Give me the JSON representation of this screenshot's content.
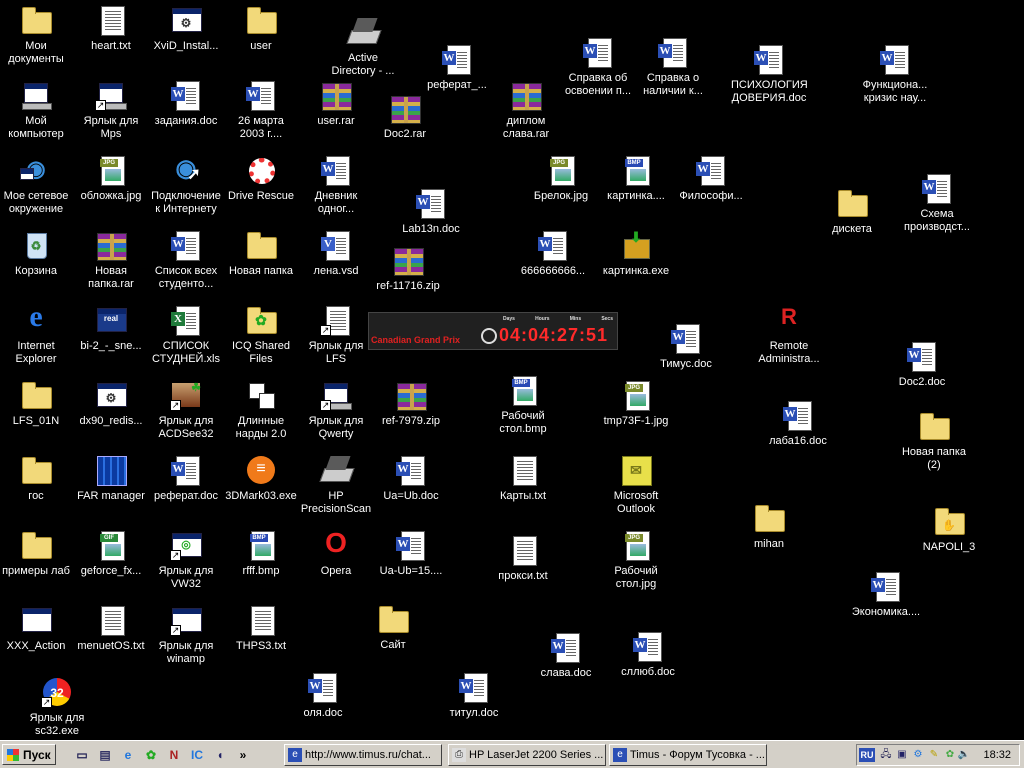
{
  "colors": {
    "desktop": "#000000",
    "taskbar": "#d4d0c8",
    "label": "#ffffff",
    "word_blue": "#2b4fb5",
    "timer_red": "#ff2a2a"
  },
  "icons": [
    {
      "label": "Мои\nдокументы",
      "kind": "folder"
    },
    {
      "label": "heart.txt",
      "kind": "txt"
    },
    {
      "label": "XviD_Instal...",
      "kind": "setup"
    },
    {
      "label": "user",
      "kind": "folder"
    },
    {
      "label": "Active\nDirectory - ...",
      "kind": "scanner"
    },
    {
      "label": "реферат_...",
      "kind": "doc"
    },
    {
      "label": "Справка об\nосвоении п...",
      "kind": "doc"
    },
    {
      "label": "Справка о\nналичии к...",
      "kind": "doc"
    },
    {
      "label": "ПСИХОЛОГИЯ\nДОВЕРИЯ.doc",
      "kind": "doc"
    },
    {
      "label": "Функциона...\nкризис нау...",
      "kind": "doc"
    },
    {
      "label": "Мой\nкомпьютер",
      "kind": "computer"
    },
    {
      "label": "Ярлык для\nMps",
      "kind": "computer",
      "shortcut": true
    },
    {
      "label": "задания.doc",
      "kind": "doc"
    },
    {
      "label": "26 марта\n2003 г....",
      "kind": "doc"
    },
    {
      "label": "user.rar",
      "kind": "rar"
    },
    {
      "label": "Doc2.rar",
      "kind": "rar"
    },
    {
      "label": "диплом\nслава.rar",
      "kind": "rar"
    },
    {
      "label": "Мое сетевое\nокружение",
      "kind": "network"
    },
    {
      "label": "обложка.jpg",
      "kind": "jpg"
    },
    {
      "label": "Подключение\nк Интернету",
      "kind": "globe"
    },
    {
      "label": "Drive Rescue",
      "kind": "lifebuoy"
    },
    {
      "label": "Дневник\nодног...",
      "kind": "doc"
    },
    {
      "label": "Lab13n.doc",
      "kind": "doc"
    },
    {
      "label": "Брелок.jpg",
      "kind": "jpg"
    },
    {
      "label": "картинка....",
      "kind": "bmp"
    },
    {
      "label": "Философи...",
      "kind": "doc"
    },
    {
      "label": "дискета",
      "kind": "folder"
    },
    {
      "label": "Схема\nпроизводст...",
      "kind": "doc"
    },
    {
      "label": "Корзина",
      "kind": "bin"
    },
    {
      "label": "Новая\nпапка.rar",
      "kind": "rar"
    },
    {
      "label": "Список всех\nстуденто...",
      "kind": "doc"
    },
    {
      "label": "Новая папка",
      "kind": "folder"
    },
    {
      "label": "лена.vsd",
      "kind": "vsd"
    },
    {
      "label": "ref-11716.zip",
      "kind": "rar"
    },
    {
      "label": "666666666...",
      "kind": "doc"
    },
    {
      "label": "картинка.exe",
      "kind": "exe"
    },
    {
      "label": "Internet\nExplorer",
      "kind": "ie"
    },
    {
      "label": "bi-2_-_sne...",
      "kind": "real"
    },
    {
      "label": "СПИСОК\nСТУДНЕЙ.xls",
      "kind": "xls"
    },
    {
      "label": "ICQ Shared\nFiles",
      "kind": "icqfolder"
    },
    {
      "label": "Ярлык для\nLFS",
      "kind": "txt",
      "shortcut": true
    },
    {
      "label": "Тимус.doc",
      "kind": "doc"
    },
    {
      "label": "Remote\nAdministra...",
      "kind": "radmin"
    },
    {
      "label": "Doc2.doc",
      "kind": "doc"
    },
    {
      "label": "LFS_01N",
      "kind": "folder"
    },
    {
      "label": "dx90_redis...",
      "kind": "setup"
    },
    {
      "label": "Ярлык для\nACDSee32",
      "kind": "acdsee",
      "shortcut": true
    },
    {
      "label": "Длинные\nнарды 2.0",
      "kind": "dice"
    },
    {
      "label": "Ярлык для\nQwerty",
      "kind": "computer",
      "shortcut": true
    },
    {
      "label": "ref-7979.zip",
      "kind": "rar"
    },
    {
      "label": "Рабочий\nстол.bmp",
      "kind": "bmp"
    },
    {
      "label": "tmp73F-1.jpg",
      "kind": "jpg"
    },
    {
      "label": "лаба16.doc",
      "kind": "doc"
    },
    {
      "label": "Новая папка\n(2)",
      "kind": "folder"
    },
    {
      "label": "гос",
      "kind": "folder"
    },
    {
      "label": "FAR manager",
      "kind": "far"
    },
    {
      "label": "реферат.doc",
      "kind": "doc"
    },
    {
      "label": "3DMark03.exe",
      "kind": "3dmark"
    },
    {
      "label": "HP\nPrecisionScan",
      "kind": "scanner"
    },
    {
      "label": "Ua=Ub.doc",
      "kind": "doc"
    },
    {
      "label": "Карты.txt",
      "kind": "txt"
    },
    {
      "label": "Microsoft\nOutlook",
      "kind": "outlook"
    },
    {
      "label": "mihan",
      "kind": "folder"
    },
    {
      "label": "NAPOLI_3",
      "kind": "sharedfolder"
    },
    {
      "label": "примеры лаб",
      "kind": "folder"
    },
    {
      "label": "geforce_fx...",
      "kind": "gif"
    },
    {
      "label": "Ярлык для\nVW32",
      "kind": "vw32",
      "shortcut": true
    },
    {
      "label": "rfff.bmp",
      "kind": "bmp"
    },
    {
      "label": "Opera",
      "kind": "opera"
    },
    {
      "label": "Ua-Ub=15....",
      "kind": "doc"
    },
    {
      "label": "прокси.txt",
      "kind": "txt"
    },
    {
      "label": "Рабочий\nстол.jpg",
      "kind": "jpg"
    },
    {
      "label": "Экономика....",
      "kind": "doc"
    },
    {
      "label": "XXX_Action",
      "kind": "window"
    },
    {
      "label": "menuetOS.txt",
      "kind": "txt"
    },
    {
      "label": "Ярлык для\nwinamp",
      "kind": "window",
      "shortcut": true
    },
    {
      "label": "THPS3.txt",
      "kind": "txt"
    },
    {
      "label": "Сайт",
      "kind": "folder"
    },
    {
      "label": "слава.doc",
      "kind": "doc"
    },
    {
      "label": "сллюб.doc",
      "kind": "doc"
    },
    {
      "label": "Ярлык для\nsc32.exe",
      "kind": "sc32",
      "shortcut": true
    },
    {
      "label": "оля.doc",
      "kind": "doc"
    },
    {
      "label": "титул.doc",
      "kind": "doc"
    }
  ],
  "clock_widget": {
    "title": "Canadian Grand Prix",
    "time": "04:04:27:51",
    "units": [
      "Days",
      "Hours",
      "Mins",
      "Secs"
    ]
  },
  "taskbar": {
    "start_label": "Пуск",
    "quick_launch": [
      "show-desktop",
      "outlook",
      "ie",
      "icq",
      "opera-n",
      "ic",
      "media",
      "more"
    ],
    "more_glyph": "»",
    "tasks": [
      {
        "label": "http://www.timus.ru/chat...",
        "icon": "ie"
      },
      {
        "label": "HP LaserJet 2200 Series ...",
        "icon": "printer"
      },
      {
        "label": "Timus - Форум Тусовка - ...",
        "icon": "ie"
      }
    ],
    "tray": {
      "language": "RU",
      "clock": "18:32"
    }
  }
}
